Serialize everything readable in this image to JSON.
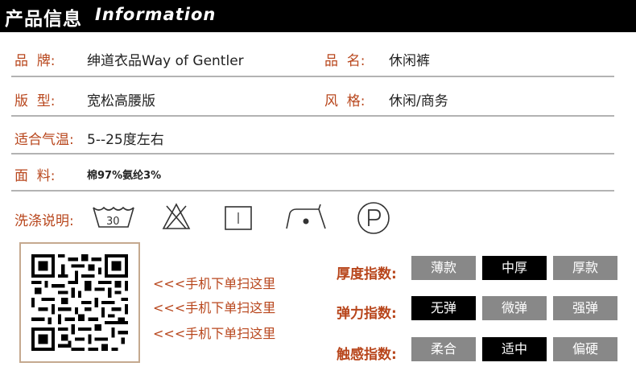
{
  "header": {
    "title_zh": "产品信息",
    "title_en": "Information"
  },
  "rows": {
    "brand_label": "品  牌:",
    "brand_value": "绅道衣品Way of Gentler",
    "name_label": "品  名:",
    "name_value": "休闲裤",
    "fit_label": "版  型:",
    "fit_value": "宽松高腰版",
    "style_label": "风  格:",
    "style_value": "休闲/商务",
    "temp_label": "适合气温:",
    "temp_value": "5--25度左右",
    "fabric_label": "面  料:",
    "fabric_value": "棉97%氨纶3%"
  },
  "wash": {
    "label": "洗涤说明:",
    "temp": "30"
  },
  "qr": {
    "scan_text": "<<<手机下单扫这里"
  },
  "indices": [
    {
      "label": "厚度指数:",
      "options": [
        "薄款",
        "中厚",
        "厚款"
      ],
      "selected": 1
    },
    {
      "label": "弹力指数:",
      "options": [
        "无弹",
        "微弹",
        "强弹"
      ],
      "selected": 0
    },
    {
      "label": "触感指数:",
      "options": [
        "柔合",
        "适中",
        "偏硬"
      ],
      "selected": 1
    }
  ],
  "colors": {
    "label": "#b8461c",
    "chip": "#888888",
    "chip_selected": "#000000",
    "rule": "#b3b3b3"
  }
}
